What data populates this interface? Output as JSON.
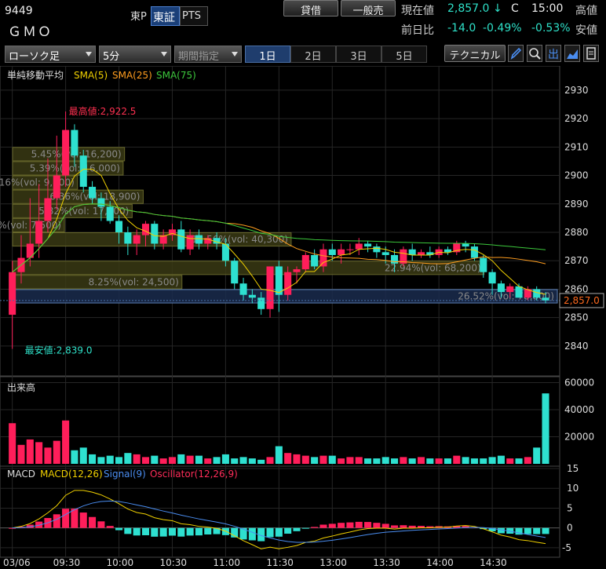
{
  "header": {
    "code": "9449",
    "name": "ＧＭＯ",
    "market_label": "東P",
    "exch_tabs": [
      "東証",
      "PTS"
    ],
    "buttons": [
      "貸借",
      "一般売"
    ],
    "price_label": "現在値",
    "price": "2,857.0",
    "price_arrow": "↓",
    "status": "C",
    "time": "15:00",
    "high_label": "高値",
    "change_label": "前日比",
    "change": "-14.0",
    "change_pct": "-0.49%",
    "change_pct2": "-0.53%",
    "low_label": "安値"
  },
  "toolbar": {
    "chart_type": "ローソク足",
    "interval": "5分",
    "period": "期間指定",
    "range_tabs": [
      "1日",
      "2日",
      "3日",
      "5日"
    ],
    "active_range": 0,
    "technical": "テクニカル",
    "icons": [
      "pencil-icon",
      "zoom-icon",
      "export-icon",
      "area-chart-icon",
      "document-icon"
    ],
    "icon_text": {
      "export-icon": "出"
    }
  },
  "price_panel": {
    "legend_title": "単純移動平均",
    "legend": [
      {
        "label": "SMA(5)",
        "color": "#f0d000"
      },
      {
        "label": "SMA(25)",
        "color": "#ff9d1e"
      },
      {
        "label": "SMA(75)",
        "color": "#3cc83c"
      }
    ],
    "yticks": [
      2930,
      2920,
      2910,
      2900,
      2890,
      2880,
      2870,
      2860,
      2850,
      2840
    ],
    "ymin": 2835,
    "ymax": 2933,
    "high_label": "最高値:2,922.5",
    "low_label": "最安値:2,839.0",
    "last_price_tag": "2,857.0",
    "volume_profile": [
      {
        "price": 2857.5,
        "pct": "26.52%",
        "vol": "78,800",
        "value": 78800,
        "highlight": true
      },
      {
        "price": 2862.5,
        "pct": "8.25%",
        "vol": "24,500",
        "value": 24500
      },
      {
        "price": 2867.5,
        "pct": "22.94%",
        "vol": "68,200",
        "value": 68200
      },
      {
        "price": 2877.5,
        "pct": "13.56%",
        "vol": "40,300",
        "value": 40300
      },
      {
        "price": 2882.5,
        "pct": "2.52%",
        "vol": "7,500",
        "value": 7500
      },
      {
        "price": 2887.5,
        "pct": "5.82%",
        "vol": "17,300",
        "value": 17300
      },
      {
        "price": 2892.5,
        "pct": "6.36%",
        "vol": "18,900",
        "value": 18900
      },
      {
        "price": 2897.5,
        "pct": "3.16%",
        "vol": "9,400",
        "value": 9400
      },
      {
        "price": 2902.5,
        "pct": "5.39%",
        "vol": "16,000",
        "value": 16000
      },
      {
        "price": 2907.5,
        "pct": "5.45%",
        "vol": "16,200",
        "value": 16200
      }
    ]
  },
  "volume_panel": {
    "title": "出来高",
    "yticks": [
      60000,
      40000,
      20000
    ]
  },
  "macd_panel": {
    "title": "MACD",
    "legend": [
      {
        "label": "MACD(12,26)",
        "color": "#f0d000"
      },
      {
        "label": "Signal(9)",
        "color": "#4a8df0"
      },
      {
        "label": "Oscillator(12,26,9)",
        "color": "#ff2d5a"
      }
    ],
    "yticks": [
      15,
      10,
      5,
      0,
      -5
    ]
  },
  "xaxis": {
    "labels": [
      "03/06",
      "09:30",
      "10:00",
      "10:30",
      "11:00",
      "11:30",
      "13:00",
      "13:30",
      "14:00",
      "14:30"
    ]
  },
  "chart_data": {
    "type": "candlestick",
    "interval": "5m",
    "date": "03/06",
    "times": [
      "09:00",
      "09:05",
      "09:10",
      "09:15",
      "09:20",
      "09:25",
      "09:30",
      "09:35",
      "09:40",
      "09:45",
      "09:50",
      "09:55",
      "10:00",
      "10:05",
      "10:10",
      "10:15",
      "10:20",
      "10:25",
      "10:30",
      "10:35",
      "10:40",
      "10:45",
      "10:50",
      "10:55",
      "11:00",
      "11:05",
      "11:10",
      "11:15",
      "11:20",
      "11:25",
      "12:30",
      "12:35",
      "12:40",
      "12:45",
      "12:50",
      "12:55",
      "13:00",
      "13:05",
      "13:10",
      "13:15",
      "13:20",
      "13:25",
      "13:30",
      "13:35",
      "13:40",
      "13:45",
      "13:50",
      "13:55",
      "14:00",
      "14:05",
      "14:10",
      "14:15",
      "14:20",
      "14:25",
      "14:30",
      "14:35",
      "14:40",
      "14:45",
      "14:50",
      "14:55",
      "15:00"
    ],
    "open": [
      2851,
      2866,
      2871,
      2876,
      2884,
      2892,
      2900,
      2916,
      2907,
      2896,
      2892,
      2889,
      2884,
      2880,
      2876,
      2879,
      2883,
      2876,
      2879,
      2881,
      2874,
      2879,
      2876,
      2878,
      2876,
      2870,
      2862,
      2858,
      2857,
      2853,
      2868,
      2858,
      2866,
      2867,
      2872,
      2868,
      2874,
      2872,
      2874,
      2874,
      2876,
      2875,
      2873,
      2872,
      2869,
      2874,
      2872,
      2873,
      2872,
      2874,
      2873,
      2876,
      2875,
      2871,
      2866,
      2862,
      2859,
      2861,
      2857,
      2860,
      2857
    ],
    "high": [
      2870,
      2879,
      2892,
      2897,
      2906,
      2914,
      2922.5,
      2918,
      2909,
      2898,
      2894,
      2891,
      2886,
      2882,
      2881,
      2884,
      2884,
      2881,
      2883,
      2884,
      2881,
      2881,
      2879,
      2880,
      2878,
      2871,
      2864,
      2860,
      2859,
      2858,
      2870,
      2868,
      2868,
      2873,
      2874,
      2876,
      2876,
      2876,
      2876,
      2878,
      2877,
      2876,
      2875,
      2874,
      2875,
      2876,
      2874,
      2875,
      2875,
      2875,
      2877,
      2877,
      2876,
      2872,
      2867,
      2863,
      2862,
      2862,
      2861,
      2861,
      2859
    ],
    "low": [
      2839,
      2862,
      2868,
      2871,
      2880,
      2888,
      2896,
      2903,
      2894,
      2890,
      2884,
      2883,
      2876,
      2872,
      2872,
      2875,
      2874,
      2874,
      2877,
      2873,
      2872,
      2874,
      2874,
      2874,
      2868,
      2860,
      2856,
      2855,
      2851,
      2850,
      2852,
      2856,
      2862,
      2866,
      2867,
      2866,
      2870,
      2869,
      2872,
      2872,
      2873,
      2871,
      2869,
      2866,
      2868,
      2870,
      2871,
      2871,
      2871,
      2872,
      2872,
      2873,
      2870,
      2864,
      2858,
      2857,
      2857,
      2857,
      2856,
      2856,
      2855
    ],
    "close": [
      2866,
      2871,
      2876,
      2884,
      2892,
      2900,
      2916,
      2907,
      2896,
      2892,
      2889,
      2884,
      2880,
      2876,
      2879,
      2883,
      2876,
      2879,
      2881,
      2874,
      2879,
      2876,
      2878,
      2876,
      2870,
      2862,
      2858,
      2857,
      2853,
      2868,
      2858,
      2866,
      2867,
      2872,
      2868,
      2874,
      2872,
      2874,
      2874,
      2876,
      2875,
      2873,
      2872,
      2869,
      2874,
      2872,
      2873,
      2872,
      2874,
      2873,
      2876,
      2875,
      2871,
      2866,
      2862,
      2859,
      2861,
      2857,
      2860,
      2857,
      2856
    ],
    "volume": [
      30000,
      14000,
      18000,
      16000,
      12000,
      17000,
      32000,
      10000,
      12000,
      7000,
      5000,
      6000,
      5000,
      8000,
      7000,
      5000,
      6000,
      4000,
      5000,
      7000,
      6000,
      6000,
      4000,
      5000,
      7000,
      4000,
      5000,
      4000,
      3000,
      5000,
      13000,
      8000,
      7000,
      6000,
      5000,
      6000,
      6000,
      4000,
      5000,
      5000,
      4000,
      4000,
      5000,
      4000,
      5000,
      4000,
      5000,
      4000,
      4000,
      4000,
      6000,
      5000,
      4000,
      4000,
      5000,
      6000,
      4000,
      4000,
      5000,
      12000,
      52000
    ],
    "macd_ylim": [
      -7,
      15
    ]
  }
}
